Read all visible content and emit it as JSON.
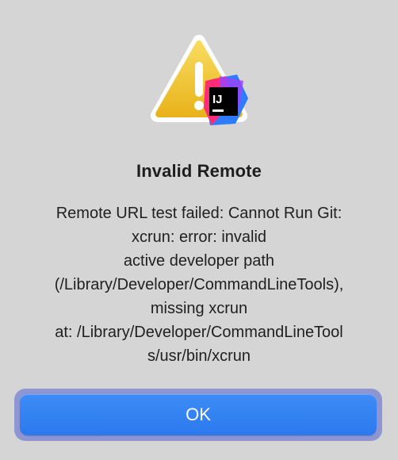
{
  "dialog": {
    "icon": "warning-triangle-with-intellij-badge-icon",
    "badge_text": "IJ",
    "title": "Invalid Remote",
    "message_lines": [
      "Remote URL test failed: Cannot Run Git:",
      "xcrun: error: invalid",
      "active developer path",
      "(/Library/Developer/CommandLineTools),",
      "missing xcrun",
      "at: /Library/Developer/CommandLineTool",
      "s/usr/bin/xcrun"
    ],
    "ok_label": "OK"
  },
  "colors": {
    "background": "#d5d5d5",
    "warning_yellow": "#f2c530",
    "button_blue": "#3583f3",
    "focus_ring": "#8d96d3"
  }
}
